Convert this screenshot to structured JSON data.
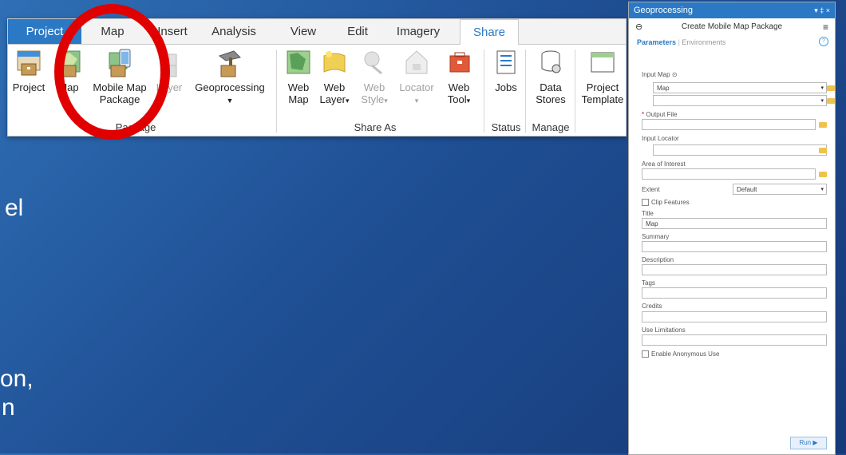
{
  "background_text": [
    "el",
    "on,",
    "n"
  ],
  "ribbon": {
    "tabs": [
      "Project",
      "Map",
      "Insert",
      "Analysis",
      "View",
      "Edit",
      "Imagery",
      "Share"
    ],
    "buttons": {
      "project": "Project",
      "map": "Map",
      "mobile_map_package_1": "Mobile Map",
      "mobile_map_package_2": "Package",
      "layer": "Layer",
      "geoprocessing": "Geoprocessing",
      "web_map_1": "Web",
      "web_map_2": "Map",
      "web_layer_1": "Web",
      "web_layer_2": "Layer",
      "web_style_1": "Web",
      "web_style_2": "Style",
      "locator": "Locator",
      "web_tool_1": "Web",
      "web_tool_2": "Tool",
      "jobs": "Jobs",
      "data_stores_1": "Data",
      "data_stores_2": "Stores",
      "project_template_1": "Project",
      "project_template_2": "Template"
    },
    "groups": {
      "package": "Package",
      "share_as": "Share As",
      "status": "Status",
      "manage": "Manage"
    }
  },
  "gp": {
    "title": "Geoprocessing",
    "controls": "▾ ‡ ×",
    "tool": "Create Mobile Map Package",
    "tab_parameters": "Parameters",
    "tab_environments": "Environments",
    "input_map_label": "Input Map",
    "input_map_value": "Map",
    "output_file_label": "Output File",
    "input_locator_label": "Input Locator",
    "aoi_label": "Area of Interest",
    "extent_label": "Extent",
    "extent_value": "Default",
    "clip_features": "Clip Features",
    "title_label": "Title",
    "title_value": "Map",
    "summary_label": "Summary",
    "description_label": "Description",
    "tags_label": "Tags",
    "credits_label": "Credits",
    "use_limitations_label": "Use Limitations",
    "anonymous_use": "Enable Anonymous Use",
    "run": "Run"
  },
  "colors": {
    "accent": "#2b79c5",
    "highlight": "#e00000",
    "folder": "#f1c24a"
  }
}
